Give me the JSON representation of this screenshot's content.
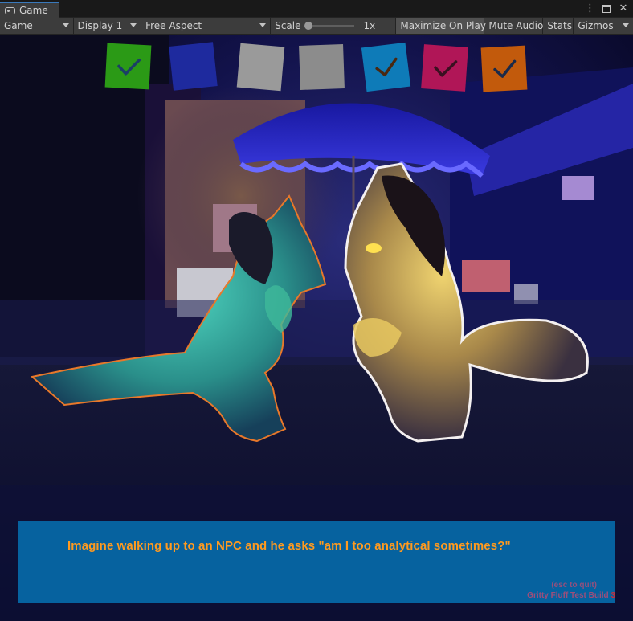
{
  "window": {
    "tab_label": "Game",
    "controls": {
      "menu": "⋮",
      "close": "✕"
    }
  },
  "toolbar": {
    "view_mode": "Game",
    "display": "Display 1",
    "aspect": "Free Aspect",
    "scale_label": "Scale",
    "scale_value": "1x",
    "scale_level": 0,
    "maximize_on_play": "Maximize On Play",
    "maximize_on_play_enabled": true,
    "mute_audio": "Mute Audio",
    "stats": "Stats",
    "gizmos": "Gizmos"
  },
  "hud": {
    "indicators": [
      {
        "color": "#2b9a16",
        "checked": true,
        "check_color": "#1b3f66"
      },
      {
        "color": "#1e2a9e",
        "checked": false,
        "check_color": ""
      },
      {
        "color": "#9a9a9a",
        "checked": false,
        "check_color": ""
      },
      {
        "color": "#8c8c8c",
        "checked": false,
        "check_color": ""
      },
      {
        "color": "#0e7bb8",
        "checked": true,
        "check_color": "#4a2810"
      },
      {
        "color": "#b01657",
        "checked": true,
        "check_color": "#3a1020"
      },
      {
        "color": "#c25a0c",
        "checked": true,
        "check_color": "#1a2a4a"
      }
    ]
  },
  "dialog": {
    "text": "Imagine walking up to an NPC and he asks \"am I too analytical sometimes?\"",
    "quit_hint": "(esc to quit)",
    "build_label": "Gritty Fluff Test Build",
    "build_number": "3"
  },
  "colors": {
    "accent_tab": "#3a79bb",
    "dialog_bg": "#0668a8",
    "dialog_text": "#ff9a1f"
  }
}
